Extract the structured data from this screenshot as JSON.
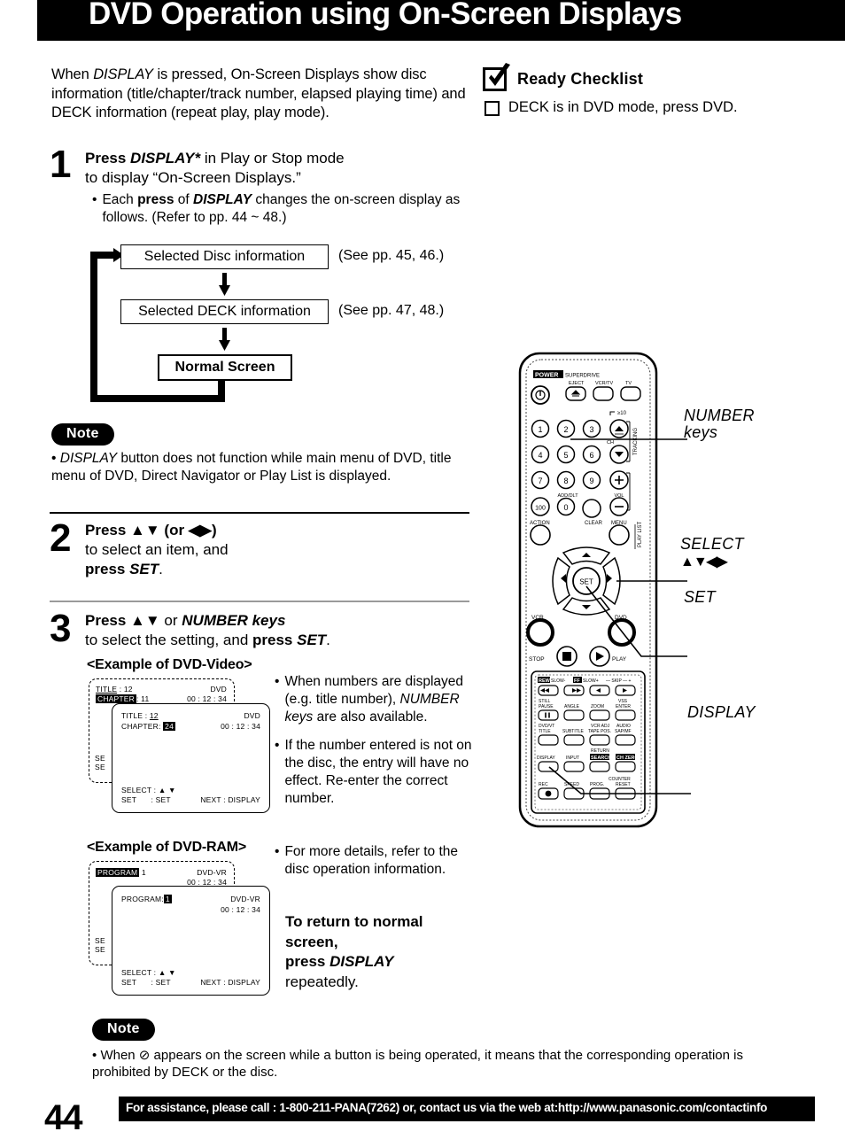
{
  "header": {
    "title": "DVD Operation using On-Screen Displays"
  },
  "intro": {
    "text_1": "When ",
    "display_italic": "DISPLAY",
    "text_2": " is pressed, On-Screen Displays show disc information (title/chapter/track number, elapsed playing time) and DECK information (repeat play, play mode)."
  },
  "checklist": {
    "title": "Ready Checklist",
    "items": [
      "DECK is in DVD mode, press DVD."
    ]
  },
  "steps": {
    "step1": {
      "number": "1",
      "line1_pre": "Press ",
      "line1_key": "DISPLAY*",
      "line1_post": " in Play or Stop mode",
      "line2": "to display “On-Screen Displays.”",
      "bullet_dot": "•",
      "bullet_pre": "Each ",
      "bullet_bold": "press",
      "bullet_mid": " of ",
      "bullet_key": "DISPLAY",
      "bullet_post": " changes the on-screen display as follows. (Refer to pp. 44 ~ 48.)"
    },
    "step2": {
      "number": "2",
      "line1": "Press ▲▼ (or ◀▶)",
      "line2": "to select an item, and",
      "line3_bold": "press ",
      "line3_key": "SET",
      "line3_end": "."
    },
    "step3": {
      "number": "3",
      "line1_bold": "Press ▲▼",
      "line1_mid": " or ",
      "line1_key": "NUMBER keys",
      "line2_pre": "to select the setting, and ",
      "line2_bold": "press ",
      "line2_key": "SET",
      "line2_end": "."
    }
  },
  "flow": {
    "box1": "Selected Disc information",
    "box2": "Selected DECK information",
    "box3": "Normal Screen",
    "note1": "(See pp. 45, 46.)",
    "note2": "(See pp. 47, 48.)"
  },
  "notes": {
    "badge": "Note",
    "note1_dot": "•",
    "note1_key": "DISPLAY",
    "note1_text": " button does not function while main menu of DVD, title menu of DVD, Direct Navigator or Play List is displayed.",
    "note2_dot": "•",
    "note2_pre": "When ",
    "note2_symbol": "⊘",
    "note2_post": " appears on the screen while a button is being operated, it means that the corresponding operation is prohibited by DECK or the disc."
  },
  "examples": {
    "video_caption": "<Example of DVD-Video>",
    "ram_caption": "<Example of DVD-RAM>",
    "video_back": {
      "label_title": "TITLE",
      "sep": ":",
      "value_title": "12",
      "label_chapter": "CHAPTER",
      "value_chapter": "11",
      "disc_type": "DVD",
      "time": "00 : 12 : 34",
      "partial1": "SE",
      "partial2": "SE"
    },
    "video_front": {
      "label_title": "TITLE",
      "sep": ":",
      "value_title": "12",
      "label_chapter": "CHAPTER",
      "value_chapter": "24",
      "disc_type": "DVD",
      "time": "00 : 12 : 34",
      "select_label": "SELECT :",
      "select_value": "▲ ▼",
      "set_label": "SET",
      "set_value": ": SET",
      "next_label": "NEXT : DISPLAY"
    },
    "ram_back": {
      "label_program": "PROGRAM",
      "value_program": "1",
      "disc_type": "DVD-VR",
      "time": "00 : 12 : 34",
      "partial1": "SE",
      "partial2": "SE"
    },
    "ram_front": {
      "label_program": "PROGRAM:",
      "value_program": "1",
      "disc_type": "DVD-VR",
      "time": "00 : 12 : 34",
      "select_label": "SELECT :",
      "select_value": "▲ ▼",
      "set_label": "SET",
      "set_value": ": SET",
      "next_label": "NEXT : DISPLAY"
    }
  },
  "right_column": {
    "bullet1_dot": "•",
    "bullet1_pre": "When numbers are displayed (e.g. title number), ",
    "bullet1_key": "NUMBER keys",
    "bullet1_post": " are also available.",
    "bullet2_dot": "•",
    "bullet2": "If the number entered is not on the disc, the entry will have no effect. Re-enter the correct number.",
    "bullet3_dot": "•",
    "bullet3": "For more details, refer to the disc operation information.",
    "return_line1": "To return to normal",
    "return_line2": "screen,",
    "return_line3_pre": "press ",
    "return_line3_key": "DISPLAY",
    "return_line4": "repeatedly."
  },
  "remote": {
    "callouts": {
      "number_keys_line1": "NUMBER",
      "number_keys_line2": "keys",
      "select_line1": "SELECT",
      "select_arrows": "▲▼◀▶",
      "set": "SET",
      "display": "DISPLAY"
    },
    "labels": {
      "power": "POWER",
      "superdrive": "SUPERDRIVE",
      "eject": "EJECT",
      "vcr_tv": "VCR/TV",
      "tv": "TV",
      "ch_up": "CH",
      "tracking": "TRACKING",
      "plus_10": "≥10",
      "add_dlt": "ADD/DLT",
      "vol": "VOL",
      "action": "ACTION",
      "clear": "CLEAR",
      "menu": "MENU",
      "playlist": "PLAY LIST",
      "set": "SET",
      "vcr": "VCR",
      "dvd": "DVD",
      "stop": "STOP",
      "play": "PLAY",
      "rew": "REW",
      "slow_minus": "SLOW-",
      "ff": "FF",
      "slow_plus": "SLOW+",
      "skip": "SKIP",
      "still_pause": "STILL PAUSE",
      "angle": "ANGLE",
      "zoom": "ZOOM",
      "vss_enter": "VSS ENTER",
      "dvd_vt_title": "DVD/VT TITLE",
      "subtitle": "SUBTITLE",
      "tape_pos": "VCR ADJ TAPE POS.",
      "audio": "AUDIO SAP/MF",
      "display": "DISPLAY",
      "input": "INPUT",
      "return_search": "RETURN SEARCH",
      "ch_zero": "CH ZERO",
      "rec": "REC",
      "speed": "SPEED",
      "prog": "PROG",
      "counter_reset": "COUNTER RESET"
    },
    "number_buttons": [
      "1",
      "2",
      "3",
      "4",
      "5",
      "6",
      "7",
      "8",
      "9",
      "100",
      "0"
    ]
  },
  "footer": {
    "page_number": "44",
    "text": "For assistance, please call : 1-800-211-PANA(7262) or, contact us via the web at:http://www.panasonic.com/contactinfo"
  }
}
